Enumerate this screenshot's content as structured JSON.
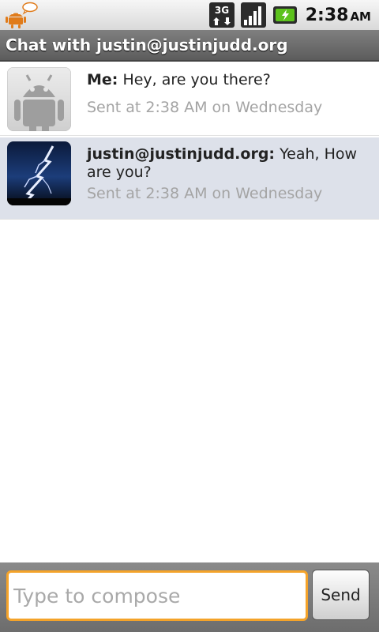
{
  "status_bar": {
    "network": "3G",
    "time": "2:38",
    "ampm": "AM"
  },
  "title": "Chat with justin@justinjudd.org",
  "messages": [
    {
      "sender": "Me:",
      "text": "Hey, are you there?",
      "timestamp": "Sent at 2:38 AM on Wednesday",
      "avatar": "android-robot-icon"
    },
    {
      "sender": "justin@justinjudd.org:",
      "text": "Yeah, How are you?",
      "timestamp": "Sent at 2:38 AM on Wednesday",
      "avatar": "lightning-photo"
    }
  ],
  "compose": {
    "placeholder": "Type to compose",
    "value": "",
    "send_label": "Send"
  },
  "colors": {
    "incoming_bg": "#dde1ea",
    "focus_border": "#f4a32a",
    "battery_green": "#5cc21c",
    "android_orange": "#e07b1a"
  }
}
